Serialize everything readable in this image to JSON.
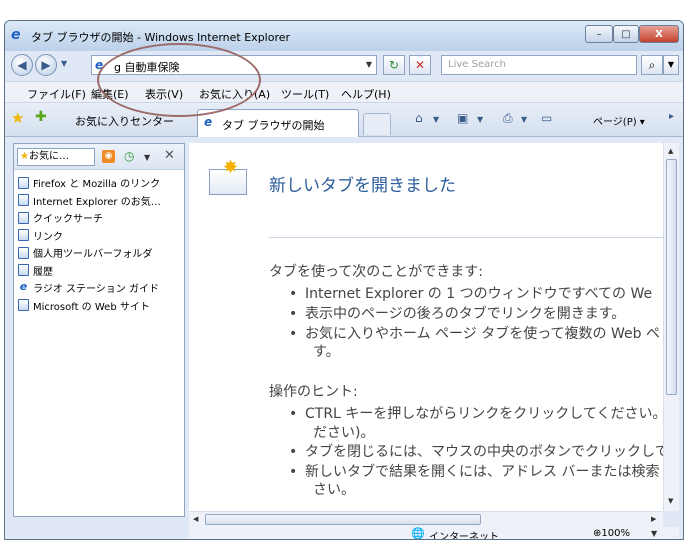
{
  "window": {
    "title": "タブ ブラウザの開始 - Windows Internet Explorer",
    "minimize_glyph": "–",
    "maximize_glyph": "□",
    "close_glyph": "X"
  },
  "nav": {
    "back_glyph": "◀",
    "forward_glyph": "▶",
    "recent_dropdown_glyph": "▼",
    "address_value": "g 自動車保険",
    "address_dropdown_glyph": "▼",
    "refresh_glyph": "↻",
    "stop_glyph": "✕",
    "search_placeholder": "Live Search",
    "search_glyph": "⌕",
    "search_dropdown_glyph": "▼"
  },
  "menu": [
    "ファイル(F)",
    "編集(E)",
    "表示(V)",
    "お気に入り(A)",
    "ツール(T)",
    "ヘルプ(H)"
  ],
  "tabbar": {
    "favorites_center_label": "お気に入りセンター",
    "tab_label": "タブ ブラウザの開始",
    "home_glyph": "⌂",
    "feeds_glyph": "▣",
    "print_glyph": "⎙",
    "page_label": "ページ(P) ▾",
    "dropdown_glyph": "▼",
    "right_arrow_glyph": "▸"
  },
  "sidebar": {
    "dropdown_label": "お気に…",
    "rss_glyph": "◉",
    "history_glyph": "◷",
    "dropdown_glyph": "▼",
    "close_glyph": "✕",
    "items": [
      {
        "label": "Firefox と Mozilla のリンク",
        "icon": "folder-icon"
      },
      {
        "label": "Internet Explorer のお気…",
        "icon": "folder-icon"
      },
      {
        "label": "クイックサーチ",
        "icon": "folder-icon"
      },
      {
        "label": "リンク",
        "icon": "folder-icon"
      },
      {
        "label": "個人用ツールバーフォルダ",
        "icon": "folder-icon"
      },
      {
        "label": "履歴",
        "icon": "folder-icon"
      },
      {
        "label": "ラジオ ステーション ガイド",
        "icon": "ie-icon"
      },
      {
        "label": "Microsoft の Web サイト",
        "icon": "folder-icon"
      }
    ]
  },
  "content": {
    "heading": "新しいタブを開きました",
    "section1_title": "タブを使って次のことができます:",
    "section1_items": [
      "Internet Explorer の 1 つのウィンドウですべての We",
      "表示中のページの後ろのタブでリンクを開きます。",
      "お気に入りやホーム ページ タブを使って複数の Web ペ"
    ],
    "section1_item3_cont": "す。",
    "section2_title": "操作のヒント:",
    "section2_items": [
      "CTRL キーを押しながらリンクをクリックしてください。",
      "タブを閉じるには、マウスの中央のボタンでクリックして",
      "新しいタブで結果を開くには、アドレス バーまたは検索"
    ],
    "section2_item1_cont": "ださい)。",
    "section2_item3_cont": "さい。",
    "bullet": "•"
  },
  "status": {
    "zone": "インターネット",
    "zoom": "100%",
    "zoom_glyph": "⊕",
    "dropdown_glyph": "▼"
  },
  "scroll": {
    "up_glyph": "▲",
    "down_glyph": "▼",
    "left_glyph": "◀",
    "right_glyph": "▶"
  },
  "colors": {
    "title_bar": "#c8daf0",
    "close_button": "#c2412c",
    "heading": "#2b5d9c",
    "annotation_ellipse": "#9b6a68"
  }
}
